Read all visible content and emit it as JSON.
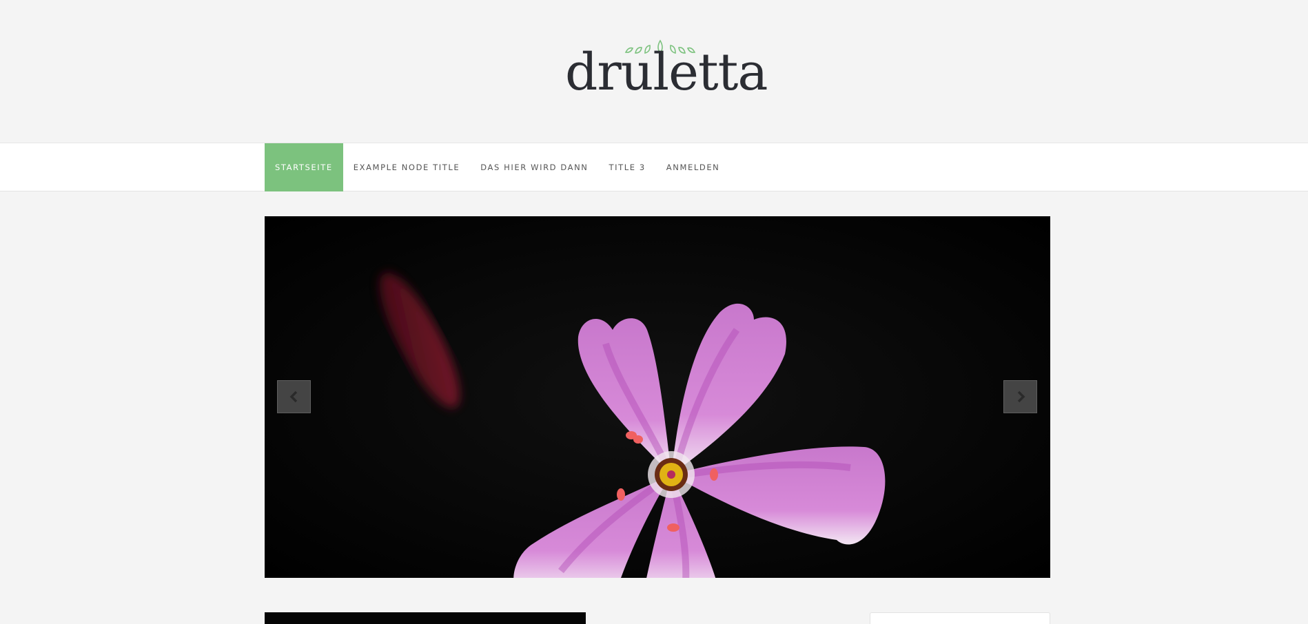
{
  "site": {
    "logo_text": "druletta",
    "logo_icon": "leaves-crown-icon",
    "accent_color": "#7cc27e"
  },
  "nav": {
    "items": [
      {
        "label": "STARTSEITE",
        "active": true
      },
      {
        "label": "EXAMPLE NODE TITLE",
        "active": false
      },
      {
        "label": "DAS HIER WIRD DANN",
        "active": false
      },
      {
        "label": "TITLE 3",
        "active": false
      },
      {
        "label": "ANMELDEN",
        "active": false
      }
    ]
  },
  "slider": {
    "image": "pink-flower-photo",
    "prev_icon": "chevron-left-icon",
    "next_icon": "chevron-right-icon"
  }
}
